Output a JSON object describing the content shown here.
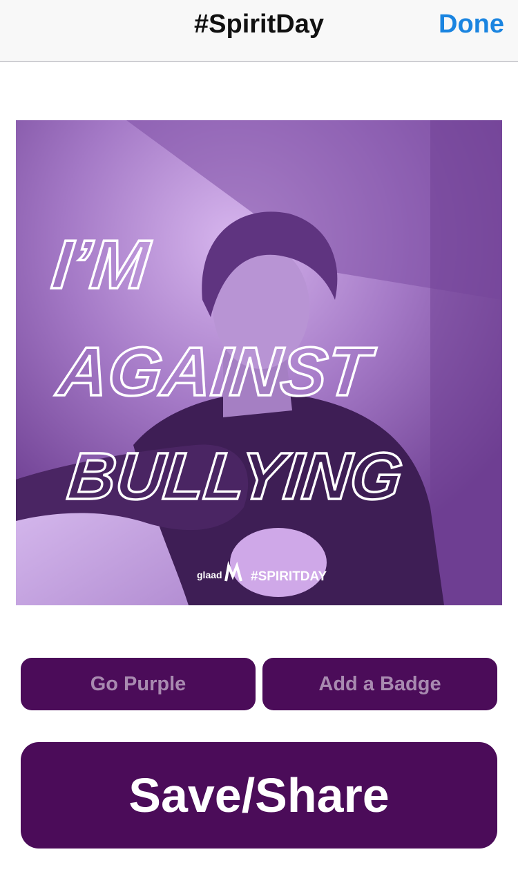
{
  "navbar": {
    "title": "#SpiritDay",
    "done_label": "Done"
  },
  "graphic": {
    "headline_lines": [
      "I’M",
      "AGAINST",
      "BULLYING"
    ],
    "brand": "glaad",
    "hashtag": "#SPIRITDAY"
  },
  "buttons": {
    "go_purple": "Go Purple",
    "add_badge": "Add a Badge",
    "save_share": "Save/Share"
  },
  "colors": {
    "accent_purple": "#4b0c59",
    "done_blue": "#1a84e0"
  }
}
